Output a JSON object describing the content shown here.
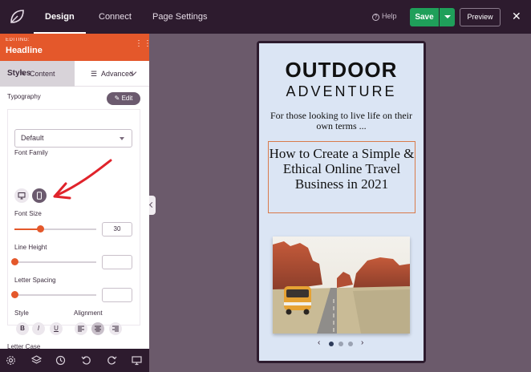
{
  "topbar": {
    "tabs": [
      "Design",
      "Connect",
      "Page Settings"
    ],
    "help_label": "Help",
    "save_label": "Save",
    "preview_label": "Preview",
    "close_glyph": "✕"
  },
  "panel": {
    "editing_caption": "EDITING:",
    "editing_title": "Headline",
    "tabs": [
      "Content",
      "Advanced"
    ],
    "styles_heading": "Styles",
    "typography_label": "Typography",
    "edit_button": "Edit",
    "font_family_label": "Font Family",
    "font_family_value": "Default",
    "font_size_label": "Font Size",
    "font_size_value": "30",
    "font_size_fraction": 0.32,
    "line_height_label": "Line Height",
    "line_height_value": "",
    "line_height_fraction": 0,
    "letter_spacing_label": "Letter Spacing",
    "letter_spacing_value": "",
    "letter_spacing_fraction": 0,
    "style_label": "Style",
    "alignment_label": "Alignment",
    "style_buttons": [
      "B",
      "I",
      "U"
    ],
    "letter_case_label": "Letter Case",
    "selected_device": "mobile",
    "accent_color": "#e4582b"
  },
  "preview": {
    "title_line1": "OUTDOOR",
    "title_line2": "ADVENTURE",
    "tagline": "For those looking to live life on their own terms ...",
    "headline": "How to Create a Simple & Ethical Online Travel Business in 2021",
    "carousel_prev": "‹",
    "carousel_next": "›",
    "carousel_active_index": 0,
    "carousel_count": 3
  }
}
